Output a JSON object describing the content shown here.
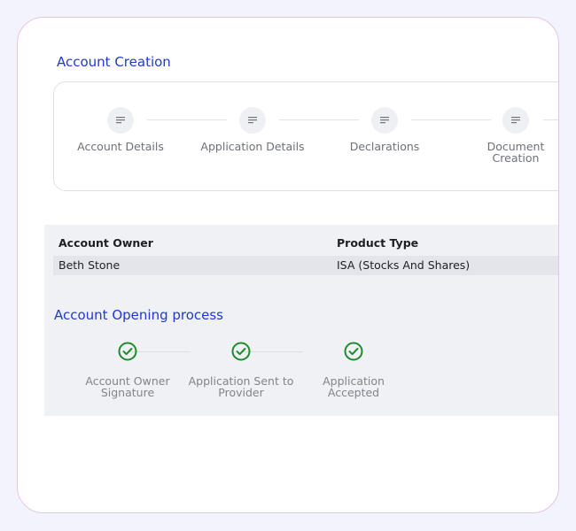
{
  "account_creation": {
    "title": "Account Creation",
    "steps": [
      {
        "label": "Account Details",
        "icon": "document-lines-icon"
      },
      {
        "label": "Application Details",
        "icon": "document-lines-icon"
      },
      {
        "label": "Declarations",
        "icon": "document-lines-icon"
      },
      {
        "label": "Document\nCreation",
        "icon": "document-lines-icon"
      }
    ]
  },
  "summary_table": {
    "headers": {
      "account_owner": "Account Owner",
      "product_type": "Product Type"
    },
    "row": {
      "account_owner": "Beth Stone",
      "product_type": "ISA (Stocks And Shares)"
    }
  },
  "account_opening": {
    "title": "Account Opening process",
    "steps": [
      {
        "label": "Account Owner\nSignature",
        "status": "complete"
      },
      {
        "label": "Application Sent to\nProvider",
        "status": "complete"
      },
      {
        "label": "Application\nAccepted",
        "status": "complete"
      }
    ]
  },
  "colors": {
    "accent": "#2138d4",
    "success": "#1f8a2e",
    "card_border": "#e6c4ea"
  }
}
